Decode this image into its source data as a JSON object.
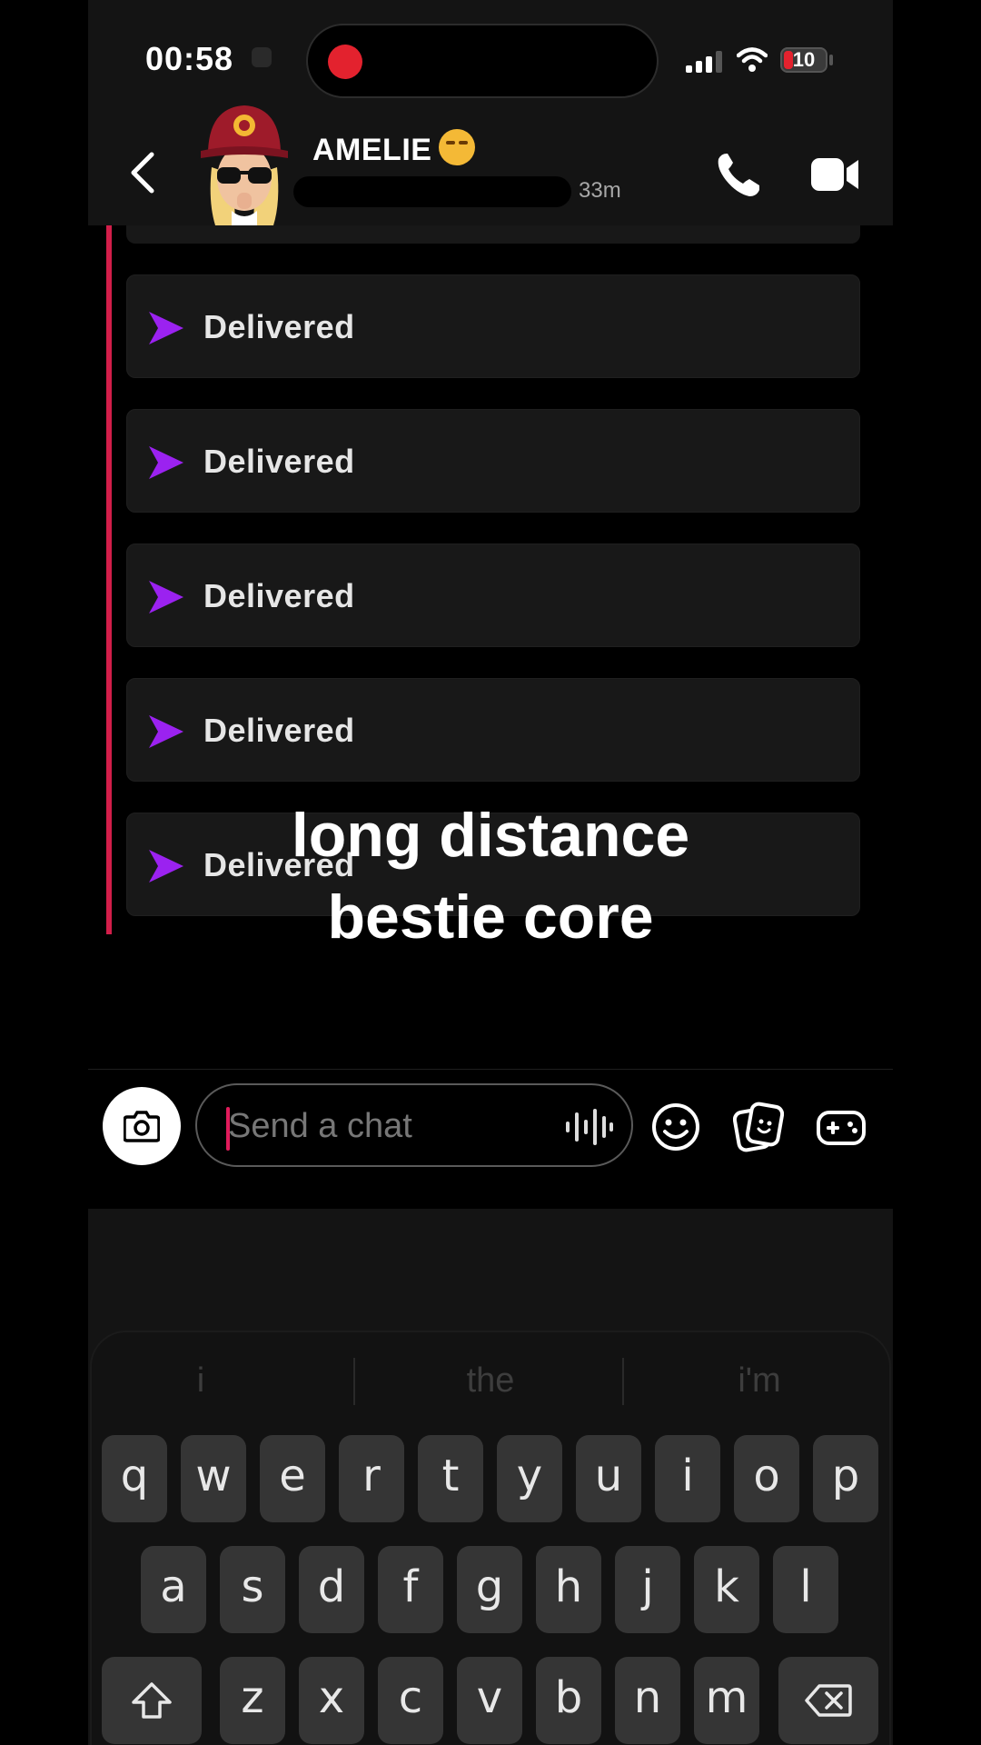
{
  "status_bar": {
    "time": "00:58",
    "battery": "10"
  },
  "header": {
    "contact_name": "AMELIE",
    "last_seen": "33m"
  },
  "messages": [
    {
      "status": "Delivered"
    },
    {
      "status": "Delivered"
    },
    {
      "status": "Delivered"
    },
    {
      "status": "Delivered"
    },
    {
      "status": "Delivered"
    }
  ],
  "overlay_caption": {
    "line1": "long distance",
    "line2": "bestie core"
  },
  "composer": {
    "placeholder": "Send a chat"
  },
  "keyboard": {
    "suggestions": [
      "i",
      "the",
      "i'm"
    ],
    "row1": [
      "q",
      "w",
      "e",
      "r",
      "t",
      "y",
      "u",
      "i",
      "o",
      "p"
    ],
    "row2": [
      "a",
      "s",
      "d",
      "f",
      "g",
      "h",
      "j",
      "k",
      "l"
    ],
    "row3": [
      "z",
      "x",
      "c",
      "v",
      "b",
      "n",
      "m"
    ]
  },
  "colors": {
    "delivered_arrow": "#9b22f0",
    "sender_bar": "#d21e4a",
    "recording": "#e3222e"
  },
  "icons": {
    "back": "chevron-left-icon",
    "call": "phone-icon",
    "video": "video-camera-icon",
    "camera": "camera-icon",
    "voice": "voice-waveform-icon",
    "emoji": "smiley-icon",
    "stickers": "sticker-icon",
    "games": "game-controller-icon",
    "shift": "shift-arrow-icon",
    "delete": "backspace-icon"
  }
}
